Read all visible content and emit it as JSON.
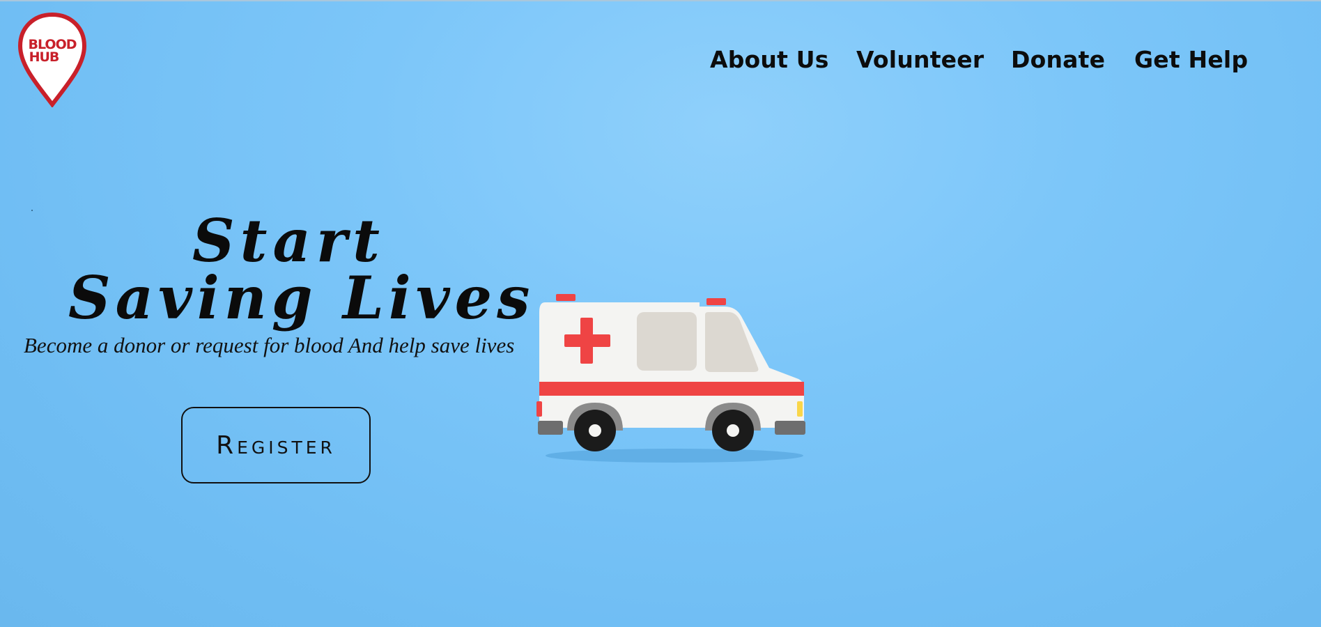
{
  "brand": {
    "logo_line1": "BLOOD",
    "logo_line2": "HUB",
    "logo_color": "#c8202a"
  },
  "nav": {
    "items": [
      {
        "label": "About Us"
      },
      {
        "label": "Volunteer"
      },
      {
        "label": "Donate"
      },
      {
        "label": "Get Help"
      }
    ]
  },
  "hero": {
    "title_line1": "Start",
    "title_line2": "Saving Lives",
    "subtitle": "Become a donor or request for blood  And help save lives",
    "register_label": "Register"
  },
  "icons": {
    "ambulance": "ambulance-illustration",
    "logo": "location-pin-logo"
  },
  "colors": {
    "background": "#7cc6f9",
    "text": "#0c0c0c",
    "accent_red": "#ef4444"
  }
}
